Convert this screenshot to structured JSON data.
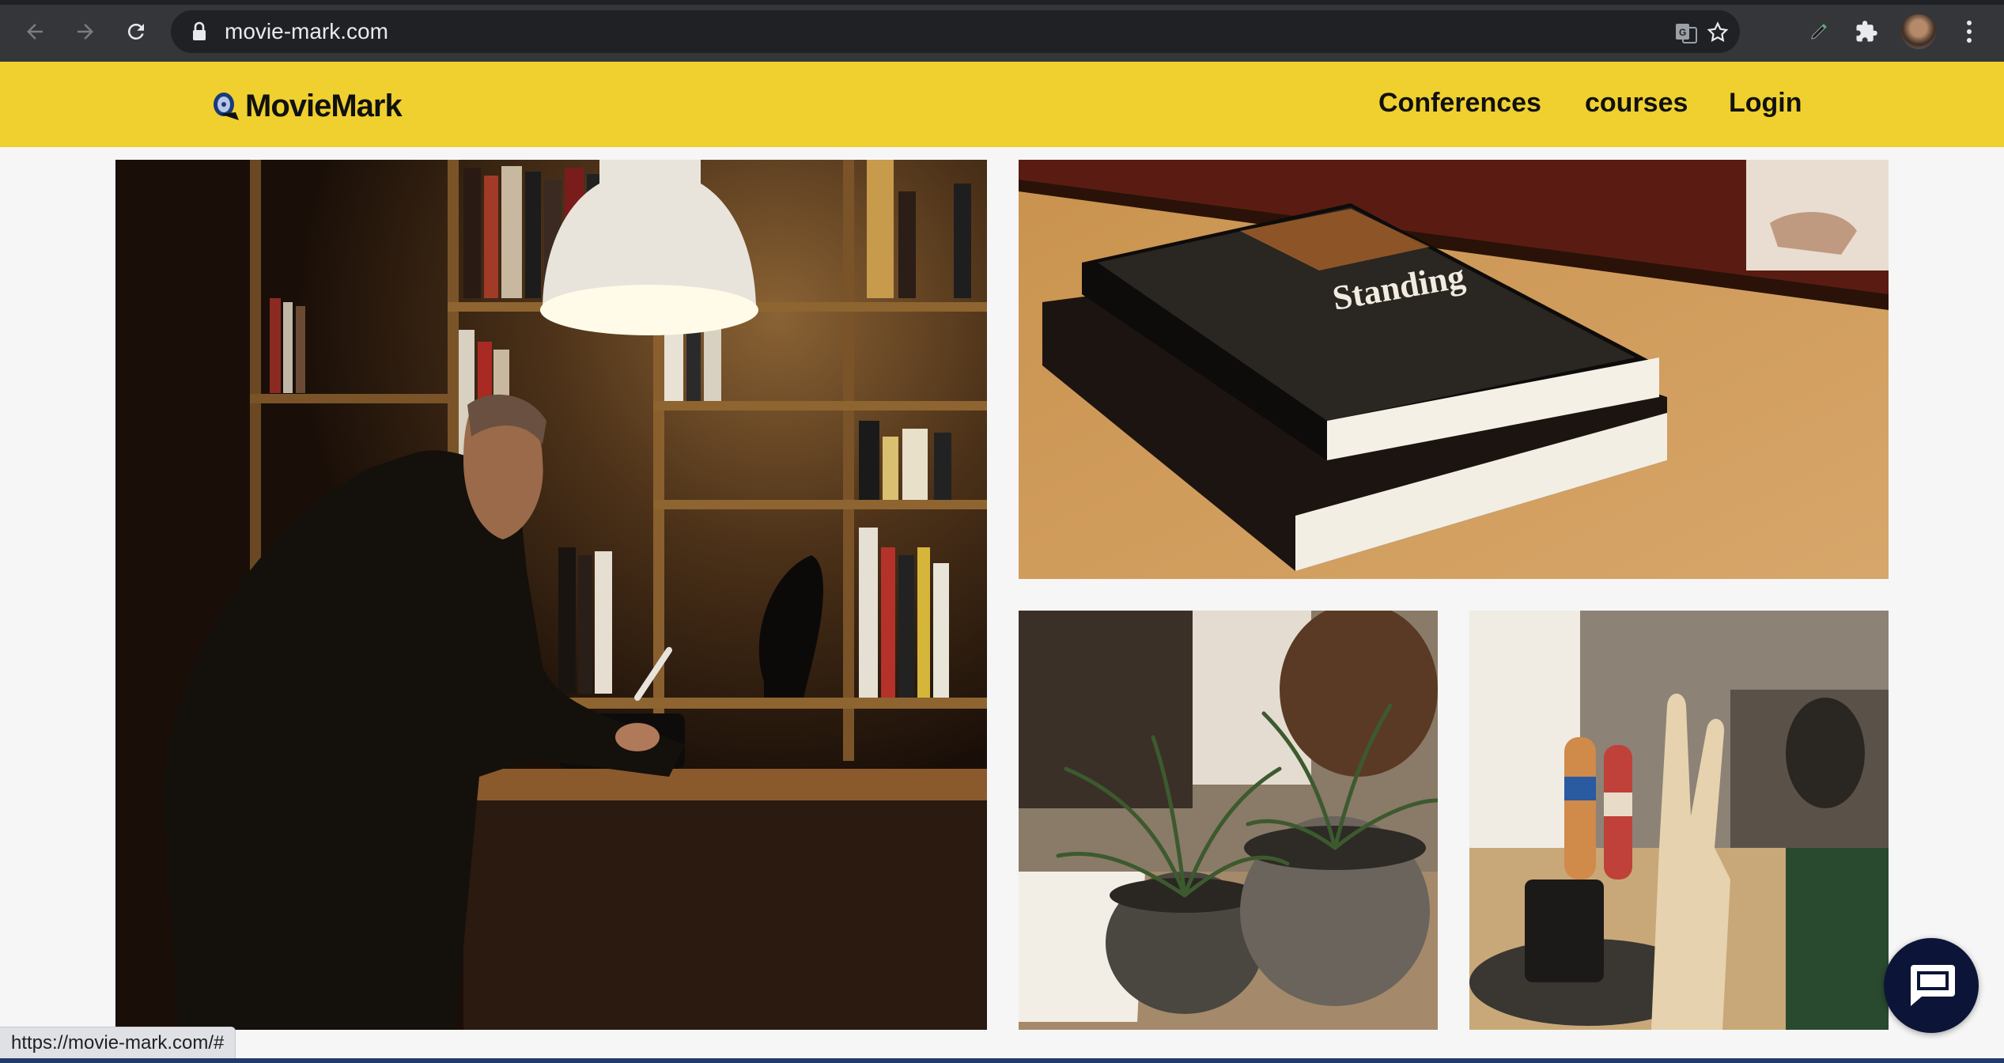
{
  "browser": {
    "url": "movie-mark.com"
  },
  "header": {
    "logo_text": "MovieMark",
    "nav": [
      {
        "label": "Conferences"
      },
      {
        "label": "courses"
      },
      {
        "label": "Login"
      }
    ],
    "background_color": "#efd02f"
  },
  "gallery": {
    "photos": [
      {
        "name": "man-writing-at-desk"
      },
      {
        "name": "stacked-books-on-table"
      },
      {
        "name": "potted-plants"
      },
      {
        "name": "wooden-figures-desk"
      }
    ],
    "book_cover_title": "Standing"
  },
  "status_bar": {
    "hover_url": "https://movie-mark.com/#"
  },
  "chat": {
    "icon": "chat-bubble-icon",
    "color": "#0c1537"
  }
}
